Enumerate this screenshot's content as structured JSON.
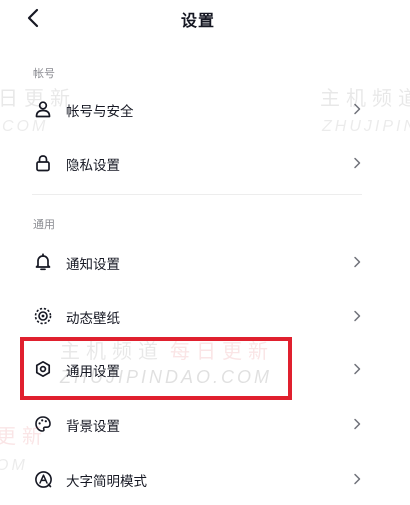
{
  "header": {
    "title": "设置",
    "back_icon": "chevron-left-icon"
  },
  "sections": [
    {
      "title": "帐号",
      "items": [
        {
          "label": "帐号与安全",
          "icon": "person-icon"
        },
        {
          "label": "隐私设置",
          "icon": "lock-icon"
        }
      ]
    },
    {
      "title": "通用",
      "items": [
        {
          "label": "通知设置",
          "icon": "bell-icon"
        },
        {
          "label": "动态壁纸",
          "icon": "live-wallpaper-icon"
        },
        {
          "label": "通用设置",
          "icon": "gear-icon"
        },
        {
          "label": "背景设置",
          "icon": "palette-icon"
        },
        {
          "label": "大字简明模式",
          "icon": "text-size-icon"
        }
      ]
    }
  ],
  "highlight": {
    "color": "#e0202e",
    "target": "通用设置"
  },
  "watermark": {
    "top_right_cn": "主机频道",
    "top_right_en": "ZHUJIPIN",
    "top_left_cn": "日更新",
    "top_left_en": "COM",
    "center_cn_1": "主机频道",
    "center_cn_2": "每日更新",
    "center_en": "ZHUJIPINDAO.COM",
    "bottom_left_cn": "更新",
    "bottom_left_en": "OM"
  },
  "colors": {
    "text": "#161823",
    "secondary_text": "#8a8b91",
    "divider": "#ededed",
    "background": "#ffffff"
  }
}
